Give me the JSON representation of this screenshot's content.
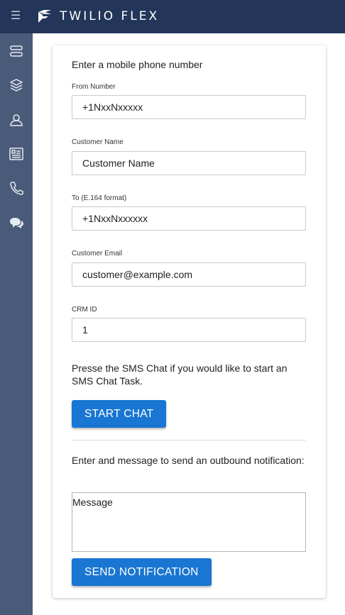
{
  "header": {
    "brand": "TWILIO FLEX",
    "menu_icon": "hamburger-menu-icon",
    "logo_icon": "twilio-flex-logo"
  },
  "sidebar": {
    "items": [
      {
        "icon": "agent-desktop-icon"
      },
      {
        "icon": "layers-icon"
      },
      {
        "icon": "teams-icon"
      },
      {
        "icon": "queues-stats-icon"
      },
      {
        "icon": "phone-icon"
      },
      {
        "icon": "chat-icon"
      }
    ]
  },
  "form": {
    "heading": "Enter a mobile phone number",
    "from_label": "From Number",
    "from_value": "+1NxxNxxxxx",
    "name_label": "Customer Name",
    "name_value": "Customer Name",
    "to_label": "To (E.164 format)",
    "to_value": "+1NxxNxxxxxx",
    "email_label": "Customer Email",
    "email_value": "customer@example.com",
    "crm_label": "CRM ID",
    "crm_value": "1",
    "chat_instructions": "Presse the SMS Chat if you would like to start an SMS Chat Task.",
    "start_chat_label": "START CHAT",
    "notification_instructions": "Enter and message to send an outbound notification:",
    "message_placeholder": "Message",
    "send_notification_label": "SEND NOTIFICATION"
  },
  "colors": {
    "topbar": "#233659",
    "sidebar": "#4a5b79",
    "primary_button": "#1976d2"
  }
}
